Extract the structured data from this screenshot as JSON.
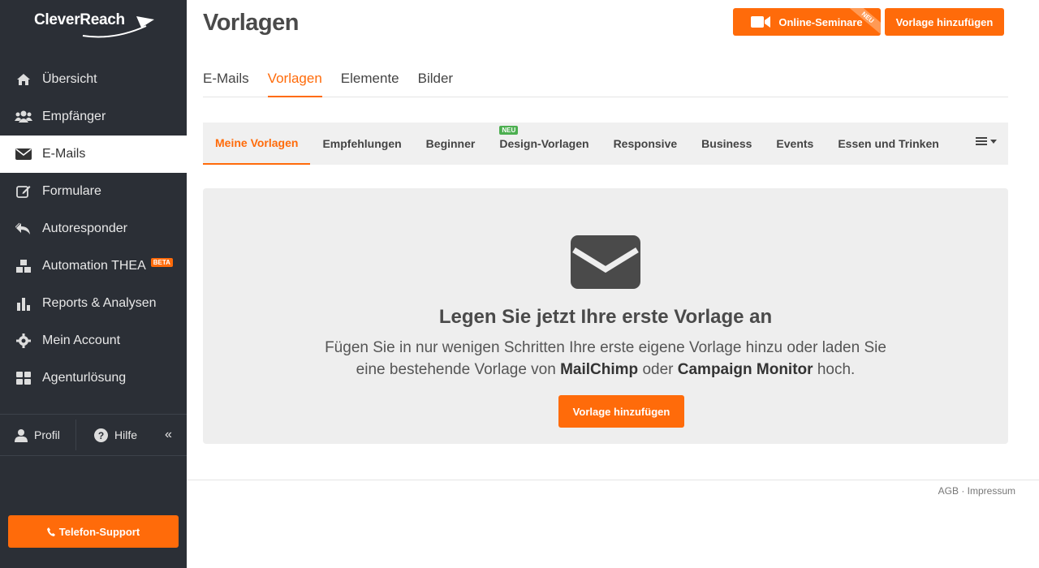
{
  "brand": {
    "logo_text": "CleverReach",
    "accent": "#ff6b0a",
    "sidebar_bg": "#2b2f36"
  },
  "sidebar": {
    "items": [
      {
        "label": "Übersicht",
        "icon": "home-icon"
      },
      {
        "label": "Empfänger",
        "icon": "users-icon"
      },
      {
        "label": "E-Mails",
        "icon": "envelope-icon",
        "active": true
      },
      {
        "label": "Formulare",
        "icon": "edit-icon"
      },
      {
        "label": "Autoresponder",
        "icon": "reply-icon"
      },
      {
        "label": "Automation THEA",
        "icon": "cubes-icon",
        "badge": "BETA"
      },
      {
        "label": "Reports & Analysen",
        "icon": "bar-chart-icon"
      },
      {
        "label": "Mein Account",
        "icon": "gear-icon"
      },
      {
        "label": "Agenturlösung",
        "icon": "grid-icon"
      }
    ],
    "profil_label": "Profil",
    "hilfe_label": "Hilfe",
    "collapse_label": "«",
    "support_label": "Telefon-Support"
  },
  "header": {
    "title": "Vorlagen",
    "seminare_label": "Online-Seminare",
    "seminare_badge": "NEU",
    "add_template_label": "Vorlage hinzufügen"
  },
  "tabs": [
    {
      "label": "E-Mails"
    },
    {
      "label": "Vorlagen",
      "active": true
    },
    {
      "label": "Elemente"
    },
    {
      "label": "Bilder"
    }
  ],
  "subtabs": [
    {
      "label": "Meine Vorlagen",
      "active": true
    },
    {
      "label": "Empfehlungen"
    },
    {
      "label": "Beginner"
    },
    {
      "label": "Design-Vorlagen",
      "badge": "NEU"
    },
    {
      "label": "Responsive"
    },
    {
      "label": "Business"
    },
    {
      "label": "Events"
    },
    {
      "label": "Essen und Trinken"
    }
  ],
  "empty_state": {
    "title": "Legen Sie jetzt Ihre erste Vorlage an",
    "text_part1": "Fügen Sie in nur wenigen Schritten Ihre erste eigene Vorlage hinzu oder laden Sie eine bestehende Vorlage von ",
    "mailchimp": "MailChimp",
    "text_part2": " oder ",
    "campaign_monitor": "Campaign Monitor",
    "text_part3": " hoch.",
    "button_label": "Vorlage hinzufügen"
  },
  "footer": {
    "links": "AGB · Impressum"
  }
}
